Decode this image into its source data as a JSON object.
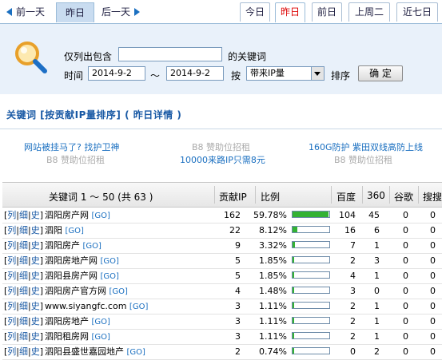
{
  "nav": {
    "prev_day": "前一天",
    "current_day": "昨日",
    "next_day": "后一天"
  },
  "tabs": [
    {
      "label": "今日",
      "active": false
    },
    {
      "label": "昨日",
      "active": true
    },
    {
      "label": "前日",
      "active": false
    },
    {
      "label": "上周二",
      "active": false
    },
    {
      "label": "近七日",
      "active": false
    }
  ],
  "search": {
    "contain_label": "仅列出包含",
    "keyword_value": "",
    "keyword_suffix": "的关键词",
    "time_label": "时间",
    "date_from": "2014-9-2",
    "tilde": "～",
    "date_to": "2014-9-2",
    "by_label": "按",
    "sort_select": "带来IP量",
    "sort_label": "排序",
    "confirm_button": "确 定"
  },
  "section_title": "关键词 [按贡献IP量排序] ( 昨日详情 )",
  "ads": {
    "left_1": "网站被挂马了? 找护卫神",
    "left_2": "B8 赞助位招租",
    "mid_1": "B8 赞助位招租",
    "mid_2": "10000来路IP只需8元",
    "right_1": "160G防护 紫田双线高防上线",
    "right_2": "B8 赞助位招租"
  },
  "table": {
    "headers": {
      "keyword": "关键词 1 ～ 50 (共 63 )",
      "ip": "贡献IP",
      "ratio": "比例",
      "baidu": "百度",
      "s360": "360",
      "google": "谷歌",
      "sogou": "搜搜"
    },
    "row_links": {
      "list": "列",
      "detail": "细",
      "history": "史",
      "go": "[GO]"
    },
    "rows": [
      {
        "keyword": "泗阳房产网",
        "ip": "162",
        "ratio": "59.78%",
        "fill": 0.5978,
        "baidu": "104",
        "s360": "45",
        "google": "0",
        "sogou": "0"
      },
      {
        "keyword": "泗阳",
        "ip": "22",
        "ratio": "8.12%",
        "fill": 0.0812,
        "baidu": "16",
        "s360": "6",
        "google": "0",
        "sogou": "0"
      },
      {
        "keyword": "泗阳房产",
        "ip": "9",
        "ratio": "3.32%",
        "fill": 0.0332,
        "baidu": "7",
        "s360": "1",
        "google": "0",
        "sogou": "0"
      },
      {
        "keyword": "泗阳房地产网",
        "ip": "5",
        "ratio": "1.85%",
        "fill": 0.0185,
        "baidu": "2",
        "s360": "3",
        "google": "0",
        "sogou": "0"
      },
      {
        "keyword": "泗阳县房产网",
        "ip": "5",
        "ratio": "1.85%",
        "fill": 0.0185,
        "baidu": "4",
        "s360": "1",
        "google": "0",
        "sogou": "0"
      },
      {
        "keyword": "泗阳房产官方网",
        "ip": "4",
        "ratio": "1.48%",
        "fill": 0.0148,
        "baidu": "3",
        "s360": "0",
        "google": "0",
        "sogou": "0"
      },
      {
        "keyword": "www.siyangfc.com",
        "ip": "3",
        "ratio": "1.11%",
        "fill": 0.0111,
        "baidu": "2",
        "s360": "1",
        "google": "0",
        "sogou": "0"
      },
      {
        "keyword": "泗阳房地产",
        "ip": "3",
        "ratio": "1.11%",
        "fill": 0.0111,
        "baidu": "2",
        "s360": "1",
        "google": "0",
        "sogou": "0"
      },
      {
        "keyword": "泗阳租房网",
        "ip": "3",
        "ratio": "1.11%",
        "fill": 0.0111,
        "baidu": "2",
        "s360": "1",
        "google": "0",
        "sogou": "0"
      },
      {
        "keyword": "泗阳县盛世嘉园地产",
        "ip": "2",
        "ratio": "0.74%",
        "fill": 0.0074,
        "baidu": "0",
        "s360": "2",
        "google": "0",
        "sogou": "0"
      }
    ]
  },
  "colors": {
    "accent_blue": "#1a6fc0",
    "bar_green": "#33b233",
    "active_red": "#dd0000",
    "panel_bg": "#e9f1fa"
  }
}
